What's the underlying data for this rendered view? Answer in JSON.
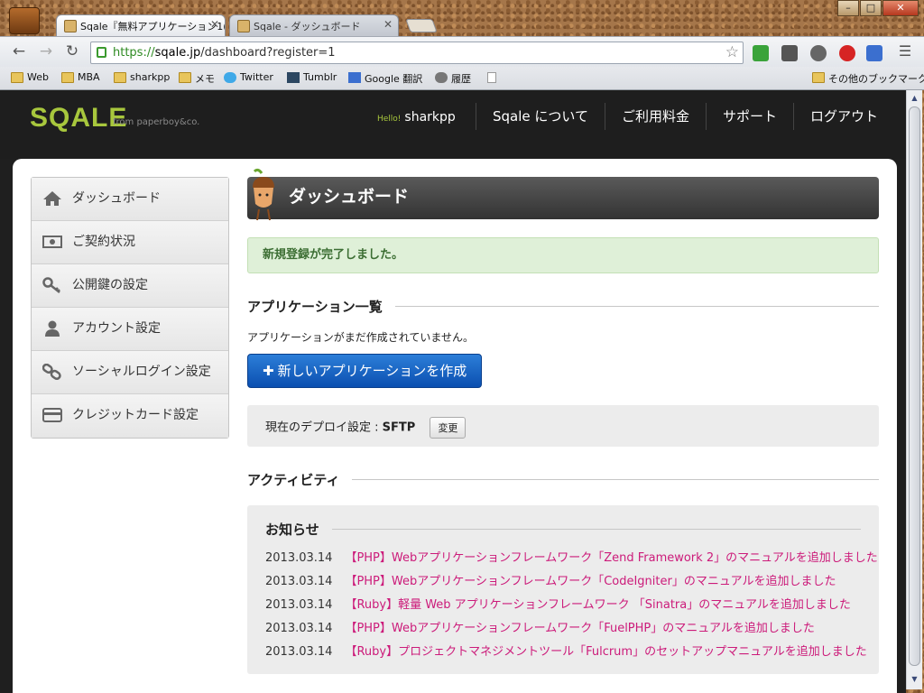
{
  "browser": {
    "tabs": [
      {
        "title": "Sqale『無料アプリケーション1(",
        "active": true
      },
      {
        "title": "Sqale - ダッシュボード",
        "active": false
      }
    ],
    "url_scheme": "https://",
    "url_host": "sqale.jp",
    "url_path": "/dashboard?register=1",
    "window_buttons": [
      "–",
      "□",
      "✕"
    ],
    "bookmarks": [
      "Web",
      "MBA",
      "sharkpp",
      "メモ",
      "Twitter",
      "Tumblr",
      "Google 翻訳",
      "履歴",
      "",
      "その他のブックマーク"
    ]
  },
  "site": {
    "logo": "SQALE",
    "logo_from": "from paperboy&co.",
    "hello_label": "Hello!",
    "username": "sharkpp",
    "nav": [
      "Sqale について",
      "ご利用料金",
      "サポート",
      "ログアウト"
    ]
  },
  "sidebar": {
    "items": [
      {
        "label": "ダッシュボード",
        "icon": "home-icon"
      },
      {
        "label": "ご契約状況",
        "icon": "money-icon"
      },
      {
        "label": "公開鍵の設定",
        "icon": "key-icon"
      },
      {
        "label": "アカウント設定",
        "icon": "user-icon"
      },
      {
        "label": "ソーシャルログイン設定",
        "icon": "link-icon"
      },
      {
        "label": "クレジットカード設定",
        "icon": "credit-card-icon"
      }
    ]
  },
  "main": {
    "title": "ダッシュボード",
    "alert": "新規登録が完了しました。",
    "apps_heading": "アプリケーション一覧",
    "apps_empty": "アプリケーションがまだ作成されていません。",
    "create_button": "新しいアプリケーションを作成",
    "create_plus": "✚",
    "deploy_label": "現在のデプロイ設定 : ",
    "deploy_value": "SFTP",
    "change_button": "変更",
    "activity_heading": "アクティビティ",
    "news_heading": "お知らせ",
    "news": [
      {
        "date": "2013.03.14",
        "text": "【PHP】Webアプリケーションフレームワーク「Zend Framework 2」のマニュアルを追加しました"
      },
      {
        "date": "2013.03.14",
        "text": "【PHP】Webアプリケーションフレームワーク「CodeIgniter」のマニュアルを追加しました"
      },
      {
        "date": "2013.03.14",
        "text": "【Ruby】軽量 Web アプリケーションフレームワーク 「Sinatra」のマニュアルを追加しました"
      },
      {
        "date": "2013.03.14",
        "text": "【PHP】Webアプリケーションフレームワーク「FuelPHP」のマニュアルを追加しました"
      },
      {
        "date": "2013.03.14",
        "text": "【Ruby】プロジェクトマネジメントツール「Fulcrum」のセットアップマニュアルを追加しました"
      }
    ]
  },
  "colors": {
    "logo_green": "#a8c73d",
    "link_pink": "#cc1b7a",
    "primary_blue": "#0b4fb0",
    "alert_green_bg": "#dff0d8"
  }
}
